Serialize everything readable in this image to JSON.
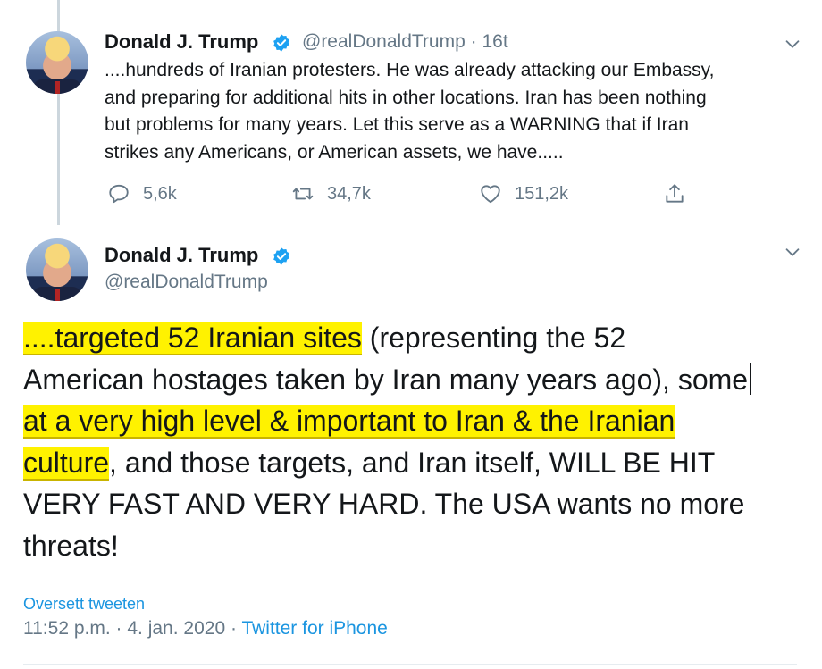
{
  "colors": {
    "accent": "#1b95e0",
    "highlight": "#fff200",
    "secondary_text": "#657786"
  },
  "tweet1": {
    "author_name": "Donald J. Trump",
    "handle": "@realDonaldTrump",
    "separator": "·",
    "time_ago": "16t",
    "text_lines": [
      "....hundreds of Iranian protesters. He was already attacking our Embassy,",
      "and preparing for additional hits in other locations. Iran has been nothing",
      "but problems for many years. Let this serve as a WARNING that if Iran",
      "strikes any Americans, or American assets, we have....."
    ],
    "replies": "5,6k",
    "retweets": "34,7k",
    "likes": "151,2k",
    "icons": {
      "reply": "reply-icon",
      "retweet": "retweet-icon",
      "like": "heart-icon",
      "share": "share-icon",
      "menu": "chevron-down-icon",
      "verified": "verified-badge-icon"
    }
  },
  "tweet2": {
    "author_name": "Donald J. Trump",
    "handle": "@realDonaldTrump",
    "line1_hl": "....targeted 52 Iranian sites",
    "line1_rest": " (representing the 52",
    "line2": "American hostages taken by Iran many years ago), some",
    "line3_hl": "at a very high level & important to Iran &  the Iranian",
    "line4_hl": "culture",
    "line4_rest": ", and those targets, and Iran itself, WILL BE HIT",
    "line5": "VERY FAST AND VERY HARD. The USA wants no more",
    "line6": "threats!",
    "translate_label": "Oversett tweeten",
    "time": "11:52 p.m.",
    "date": "4. jan. 2020",
    "dot": "·",
    "source": "Twitter for iPhone"
  }
}
